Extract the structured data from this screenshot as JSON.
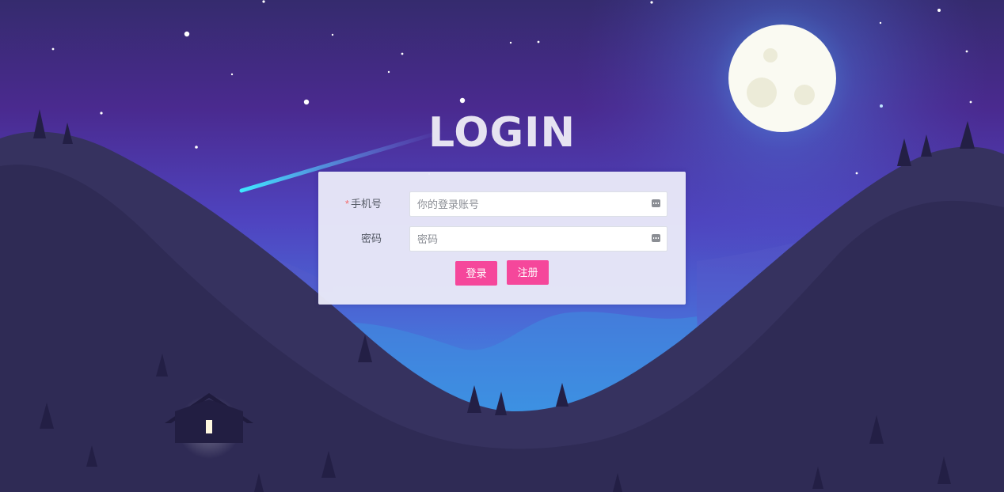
{
  "page": {
    "title": "LOGIN"
  },
  "form": {
    "phone": {
      "required_mark": "*",
      "label": "手机号",
      "placeholder": "你的登录账号",
      "value": ""
    },
    "password": {
      "label": "密码",
      "placeholder": "密码",
      "value": ""
    },
    "buttons": {
      "login_label": "登录",
      "register_label": "注册"
    }
  },
  "theme": {
    "button_color": "#f5479b",
    "sky_top": "#3a2f78",
    "sky_bottom": "#3aa3e8",
    "hill_color": "#302c55",
    "moon_color": "#fafaf2",
    "required_color": "#f56c6c"
  },
  "icons": {
    "input_suffix": "password-manager-key-icon",
    "moon": "moon-icon",
    "house": "cabin-icon",
    "shooting_star": "shooting-star-icon"
  }
}
